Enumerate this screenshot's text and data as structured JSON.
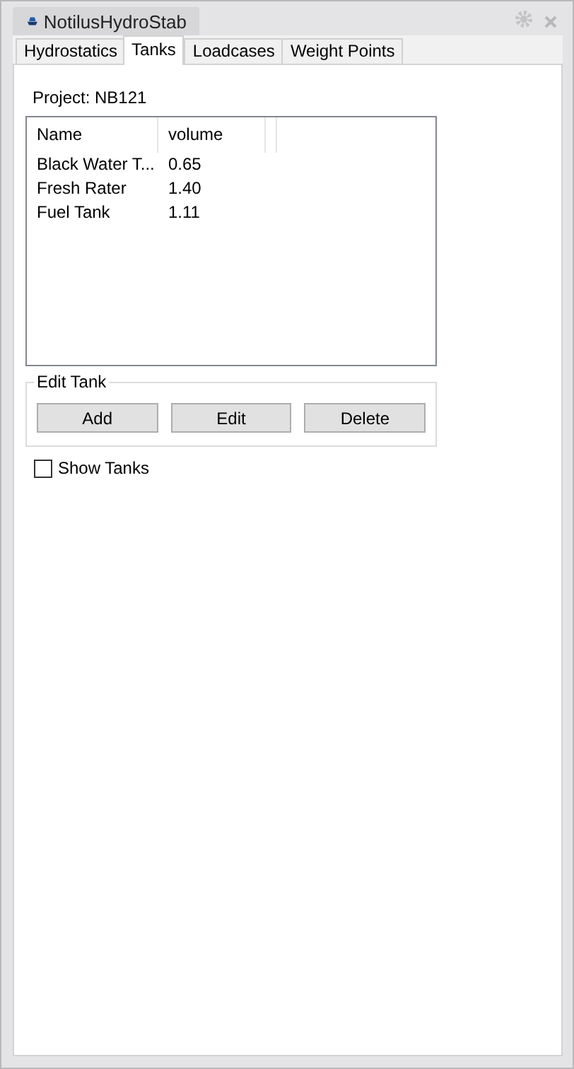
{
  "window": {
    "title": "NotilusHydroStab"
  },
  "tabs": [
    {
      "label": "Hydrostatics",
      "selected": false
    },
    {
      "label": "Tanks",
      "selected": true
    },
    {
      "label": "Loadcases",
      "selected": false
    },
    {
      "label": "Weight Points",
      "selected": false
    }
  ],
  "project_label": "Project: NB121",
  "table": {
    "columns": [
      "Name",
      "volume"
    ],
    "rows": [
      [
        "Black Water T...",
        "0.65"
      ],
      [
        "Fresh Rater",
        "1.40"
      ],
      [
        "Fuel Tank",
        "1.11"
      ]
    ]
  },
  "edit_group": {
    "title": "Edit Tank",
    "buttons": [
      "Add",
      "Edit",
      "Delete"
    ]
  },
  "show_tanks": {
    "label": "Show Tanks",
    "checked": false
  }
}
